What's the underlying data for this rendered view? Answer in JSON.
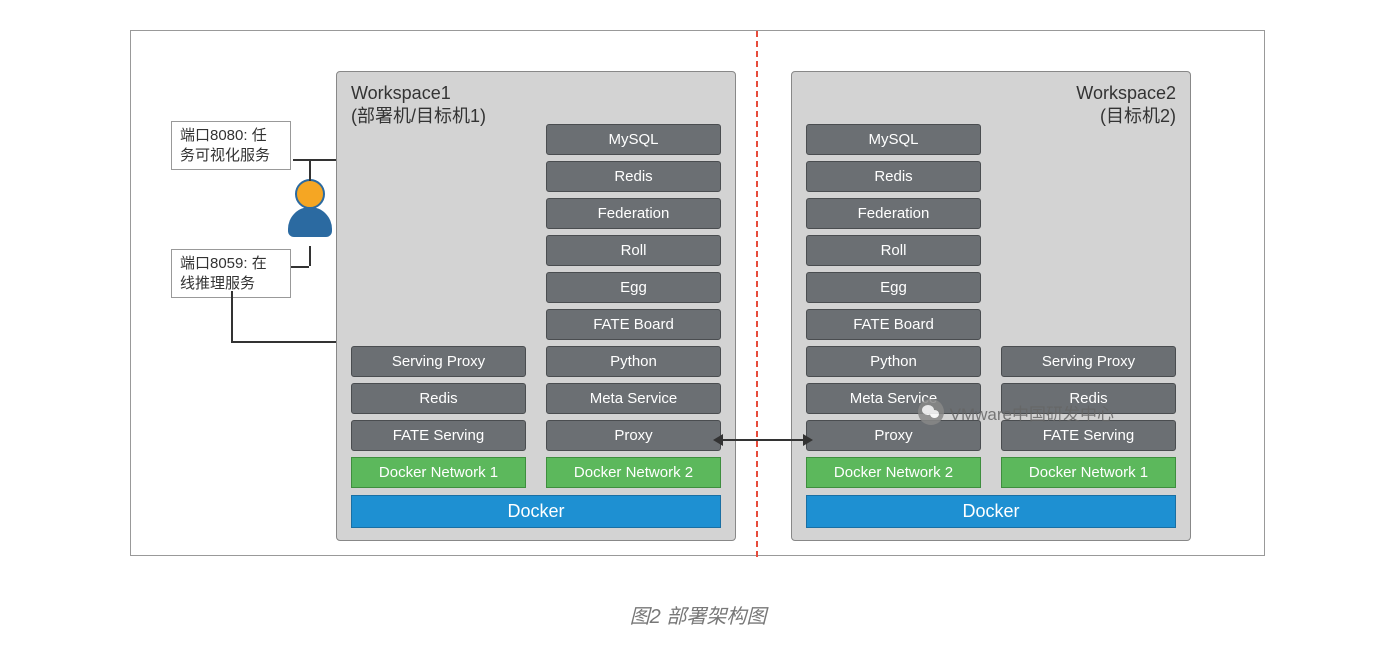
{
  "caption": "图2 部署架构图",
  "watermark": "VMware中国研发中心",
  "annotations": {
    "port8080": "端口8080: 任\n务可视化服务",
    "port8059": "端口8059: 在\n线推理服务"
  },
  "workspace1": {
    "title": "Workspace1\n(部署机/目标机1)",
    "left_stack": [
      "Serving Proxy",
      "Redis",
      "FATE Serving"
    ],
    "right_stack": [
      "MySQL",
      "Redis",
      "Federation",
      "Roll",
      "Egg",
      "FATE Board",
      "Python",
      "Meta Service",
      "Proxy"
    ],
    "net_left": "Docker Network 1",
    "net_right": "Docker Network 2",
    "docker": "Docker"
  },
  "workspace2": {
    "title": "Workspace2\n(目标机2)",
    "left_stack": [
      "MySQL",
      "Redis",
      "Federation",
      "Roll",
      "Egg",
      "FATE Board",
      "Python",
      "Meta Service",
      "Proxy"
    ],
    "right_stack": [
      "Serving Proxy",
      "Redis",
      "FATE Serving"
    ],
    "net_left": "Docker Network 2",
    "net_right": "Docker Network 1",
    "docker": "Docker"
  }
}
